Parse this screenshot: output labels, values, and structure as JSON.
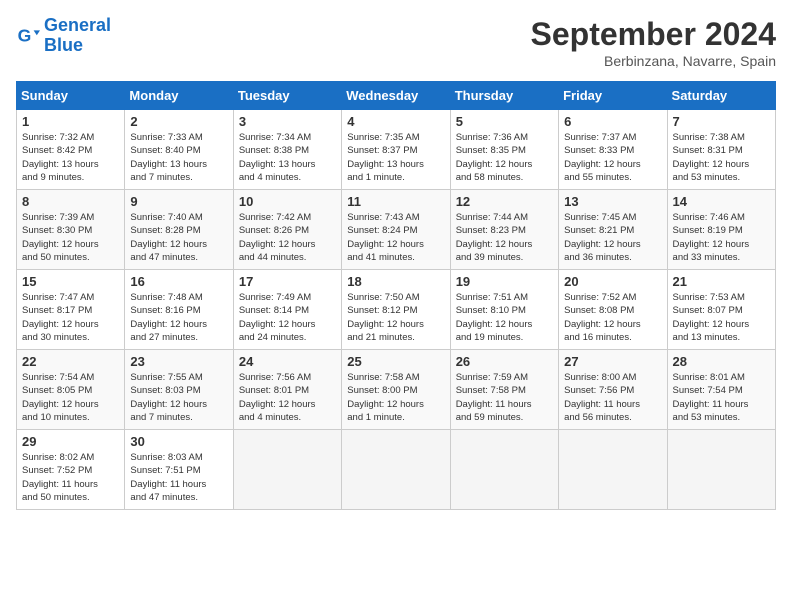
{
  "logo": {
    "text_general": "General",
    "text_blue": "Blue"
  },
  "header": {
    "month": "September 2024",
    "location": "Berbinzana, Navarre, Spain"
  },
  "columns": [
    "Sunday",
    "Monday",
    "Tuesday",
    "Wednesday",
    "Thursday",
    "Friday",
    "Saturday"
  ],
  "weeks": [
    [
      {
        "day": "1",
        "info": "Sunrise: 7:32 AM\nSunset: 8:42 PM\nDaylight: 13 hours\nand 9 minutes."
      },
      {
        "day": "2",
        "info": "Sunrise: 7:33 AM\nSunset: 8:40 PM\nDaylight: 13 hours\nand 7 minutes."
      },
      {
        "day": "3",
        "info": "Sunrise: 7:34 AM\nSunset: 8:38 PM\nDaylight: 13 hours\nand 4 minutes."
      },
      {
        "day": "4",
        "info": "Sunrise: 7:35 AM\nSunset: 8:37 PM\nDaylight: 13 hours\nand 1 minute."
      },
      {
        "day": "5",
        "info": "Sunrise: 7:36 AM\nSunset: 8:35 PM\nDaylight: 12 hours\nand 58 minutes."
      },
      {
        "day": "6",
        "info": "Sunrise: 7:37 AM\nSunset: 8:33 PM\nDaylight: 12 hours\nand 55 minutes."
      },
      {
        "day": "7",
        "info": "Sunrise: 7:38 AM\nSunset: 8:31 PM\nDaylight: 12 hours\nand 53 minutes."
      }
    ],
    [
      {
        "day": "8",
        "info": "Sunrise: 7:39 AM\nSunset: 8:30 PM\nDaylight: 12 hours\nand 50 minutes."
      },
      {
        "day": "9",
        "info": "Sunrise: 7:40 AM\nSunset: 8:28 PM\nDaylight: 12 hours\nand 47 minutes."
      },
      {
        "day": "10",
        "info": "Sunrise: 7:42 AM\nSunset: 8:26 PM\nDaylight: 12 hours\nand 44 minutes."
      },
      {
        "day": "11",
        "info": "Sunrise: 7:43 AM\nSunset: 8:24 PM\nDaylight: 12 hours\nand 41 minutes."
      },
      {
        "day": "12",
        "info": "Sunrise: 7:44 AM\nSunset: 8:23 PM\nDaylight: 12 hours\nand 39 minutes."
      },
      {
        "day": "13",
        "info": "Sunrise: 7:45 AM\nSunset: 8:21 PM\nDaylight: 12 hours\nand 36 minutes."
      },
      {
        "day": "14",
        "info": "Sunrise: 7:46 AM\nSunset: 8:19 PM\nDaylight: 12 hours\nand 33 minutes."
      }
    ],
    [
      {
        "day": "15",
        "info": "Sunrise: 7:47 AM\nSunset: 8:17 PM\nDaylight: 12 hours\nand 30 minutes."
      },
      {
        "day": "16",
        "info": "Sunrise: 7:48 AM\nSunset: 8:16 PM\nDaylight: 12 hours\nand 27 minutes."
      },
      {
        "day": "17",
        "info": "Sunrise: 7:49 AM\nSunset: 8:14 PM\nDaylight: 12 hours\nand 24 minutes."
      },
      {
        "day": "18",
        "info": "Sunrise: 7:50 AM\nSunset: 8:12 PM\nDaylight: 12 hours\nand 21 minutes."
      },
      {
        "day": "19",
        "info": "Sunrise: 7:51 AM\nSunset: 8:10 PM\nDaylight: 12 hours\nand 19 minutes."
      },
      {
        "day": "20",
        "info": "Sunrise: 7:52 AM\nSunset: 8:08 PM\nDaylight: 12 hours\nand 16 minutes."
      },
      {
        "day": "21",
        "info": "Sunrise: 7:53 AM\nSunset: 8:07 PM\nDaylight: 12 hours\nand 13 minutes."
      }
    ],
    [
      {
        "day": "22",
        "info": "Sunrise: 7:54 AM\nSunset: 8:05 PM\nDaylight: 12 hours\nand 10 minutes."
      },
      {
        "day": "23",
        "info": "Sunrise: 7:55 AM\nSunset: 8:03 PM\nDaylight: 12 hours\nand 7 minutes."
      },
      {
        "day": "24",
        "info": "Sunrise: 7:56 AM\nSunset: 8:01 PM\nDaylight: 12 hours\nand 4 minutes."
      },
      {
        "day": "25",
        "info": "Sunrise: 7:58 AM\nSunset: 8:00 PM\nDaylight: 12 hours\nand 1 minute."
      },
      {
        "day": "26",
        "info": "Sunrise: 7:59 AM\nSunset: 7:58 PM\nDaylight: 11 hours\nand 59 minutes."
      },
      {
        "day": "27",
        "info": "Sunrise: 8:00 AM\nSunset: 7:56 PM\nDaylight: 11 hours\nand 56 minutes."
      },
      {
        "day": "28",
        "info": "Sunrise: 8:01 AM\nSunset: 7:54 PM\nDaylight: 11 hours\nand 53 minutes."
      }
    ],
    [
      {
        "day": "29",
        "info": "Sunrise: 8:02 AM\nSunset: 7:52 PM\nDaylight: 11 hours\nand 50 minutes."
      },
      {
        "day": "30",
        "info": "Sunrise: 8:03 AM\nSunset: 7:51 PM\nDaylight: 11 hours\nand 47 minutes."
      },
      {
        "day": "",
        "info": ""
      },
      {
        "day": "",
        "info": ""
      },
      {
        "day": "",
        "info": ""
      },
      {
        "day": "",
        "info": ""
      },
      {
        "day": "",
        "info": ""
      }
    ]
  ]
}
